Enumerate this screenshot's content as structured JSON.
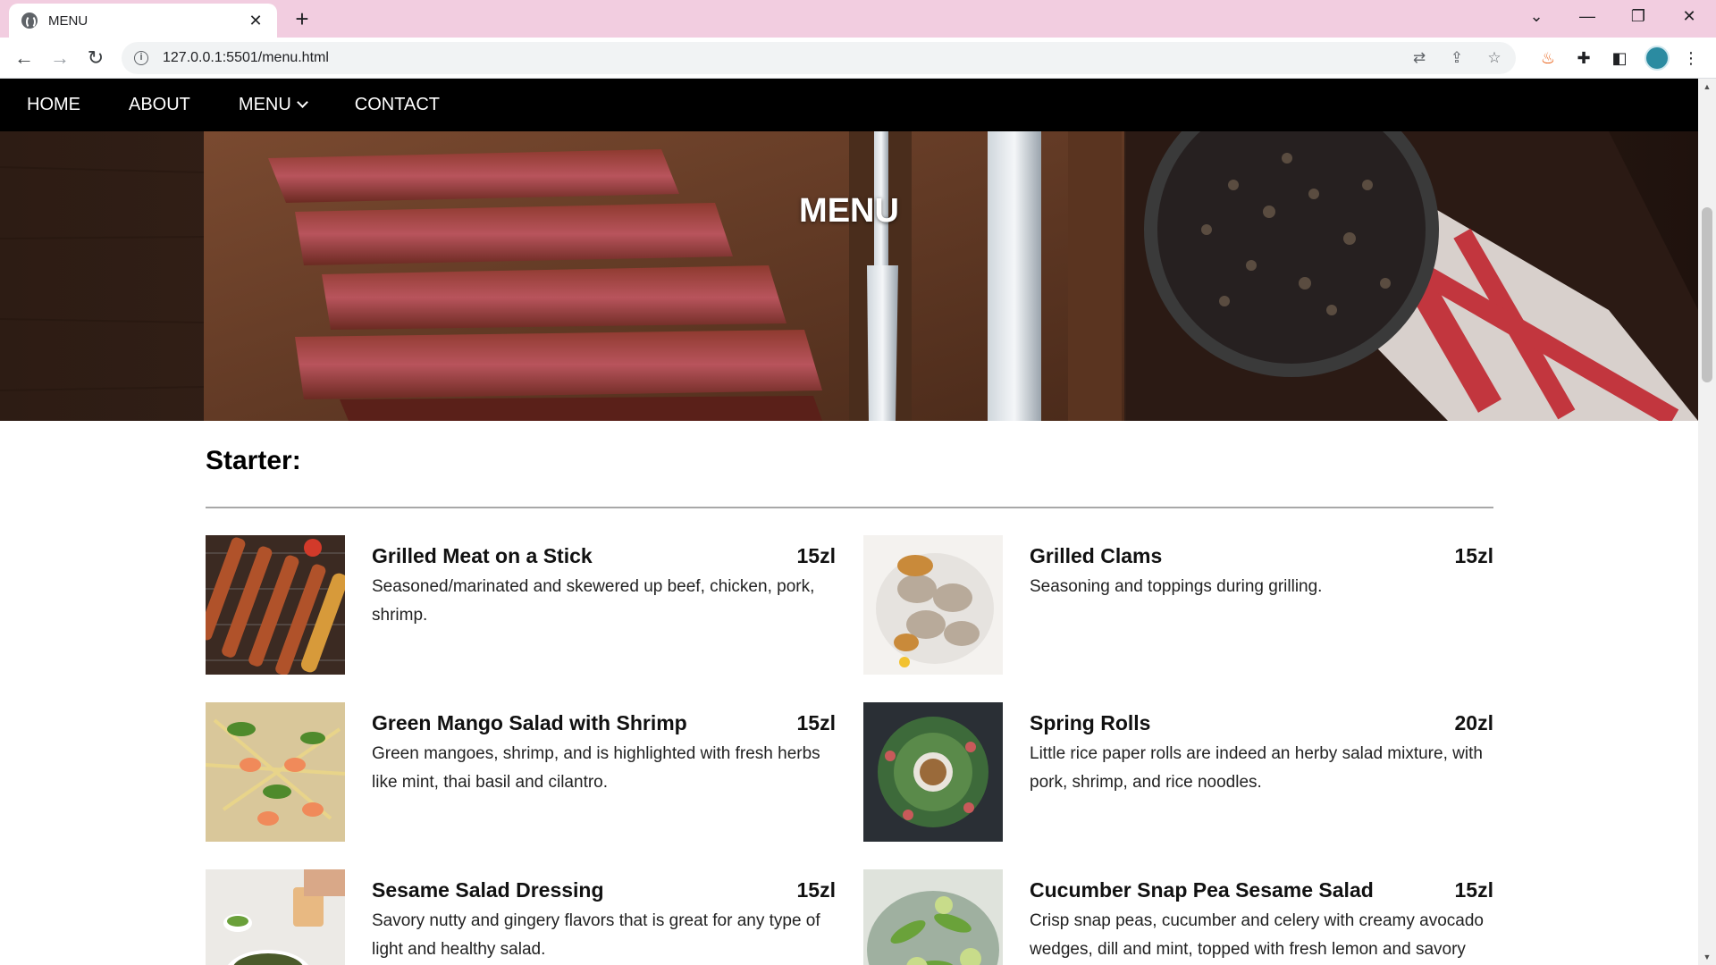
{
  "browser": {
    "tab_title": "MENU",
    "tab_close": "✕",
    "new_tab": "+",
    "url": "127.0.0.1:5501/menu.html",
    "window_controls": [
      "⌄",
      "—",
      "❐",
      "✕"
    ]
  },
  "nav": {
    "home": "HOME",
    "about": "ABOUT",
    "menu": "MENU",
    "contact": "CONTACT"
  },
  "hero": {
    "title": "MENU"
  },
  "section": {
    "title": "Starter:"
  },
  "items": [
    {
      "name": "Grilled Meat on a Stick",
      "price": "15zl",
      "desc": "Seasoned/marinated and skewered up beef, chicken, pork, shrimp."
    },
    {
      "name": "Grilled Clams",
      "price": "15zl",
      "desc": "Seasoning and toppings during grilling."
    },
    {
      "name": "Green Mango Salad with Shrimp",
      "price": "15zl",
      "desc": "Green mangoes, shrimp, and is highlighted with fresh herbs like mint, thai basil and cilantro."
    },
    {
      "name": "Spring Rolls",
      "price": "20zl",
      "desc": "Little rice paper rolls are indeed an herby salad mixture, with pork, shrimp, and rice noodles."
    },
    {
      "name": "Sesame Salad Dressing",
      "price": "15zl",
      "desc": "Savory nutty and gingery flavors that is great for any type of light and healthy salad."
    },
    {
      "name": "Cucumber Snap Pea Sesame Salad",
      "price": "15zl",
      "desc": "Crisp snap peas, cucumber and celery with creamy avocado wedges, dill and mint, topped with fresh lemon and savory sesame oil."
    }
  ],
  "colors": {
    "tabbar": "#f2cde0",
    "nav_bg": "#000000",
    "nav_text": "#ffffff"
  }
}
